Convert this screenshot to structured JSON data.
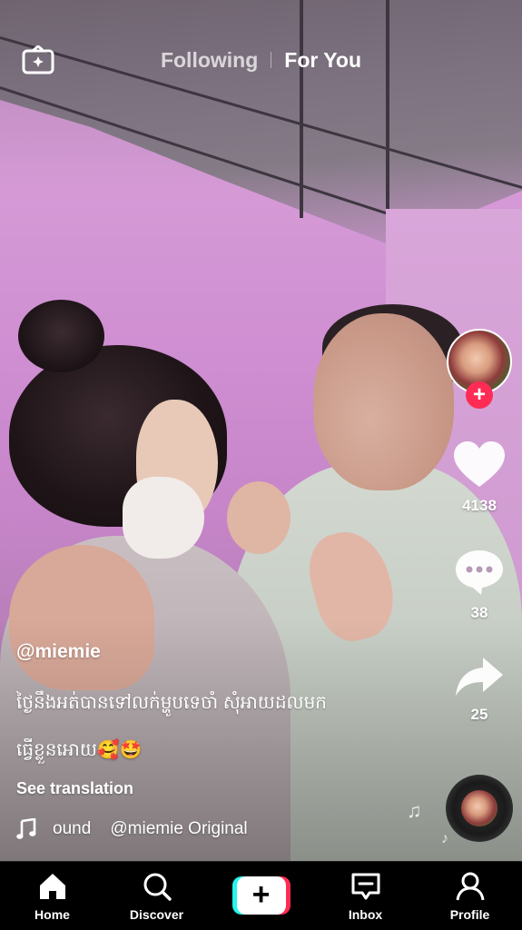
{
  "top_bar": {
    "live_icon": "tv-live-icon",
    "tabs": [
      {
        "label": "Following",
        "active": false
      },
      {
        "label": "For You",
        "active": true
      }
    ]
  },
  "right_rail": {
    "follow_icon": "plus-icon",
    "likes": {
      "icon": "heart-icon",
      "count": "4138"
    },
    "comments": {
      "icon": "comment-icon",
      "count": "38"
    },
    "shares": {
      "icon": "share-arrow-icon",
      "count": "25"
    },
    "music_disc_icon": "music-disc-icon"
  },
  "post": {
    "username": "@miemie",
    "caption_line1": "ថ្ងៃនឹងអត់បានទៅលក់ម្ហូបទេចាំ សុំអាយដលមក",
    "caption_line2": "ធ្វើខ្លួនអោយ🥰🤩",
    "see_translation": "See translation",
    "sound_icon": "music-note-icon",
    "sound_text": "ound    @miemie Original"
  },
  "bottom_nav": {
    "items": [
      {
        "label": "Home",
        "icon": "home-icon",
        "active": true
      },
      {
        "label": "Discover",
        "icon": "search-icon",
        "active": false
      },
      {
        "label": "",
        "icon": "plus-icon",
        "active": false
      },
      {
        "label": "Inbox",
        "icon": "inbox-icon",
        "active": false
      },
      {
        "label": "Profile",
        "icon": "profile-icon",
        "active": false
      }
    ]
  },
  "colors": {
    "accent_red": "#fe2c55",
    "accent_cyan": "#25f4ee",
    "wall_purple": "#cf8fd2"
  }
}
